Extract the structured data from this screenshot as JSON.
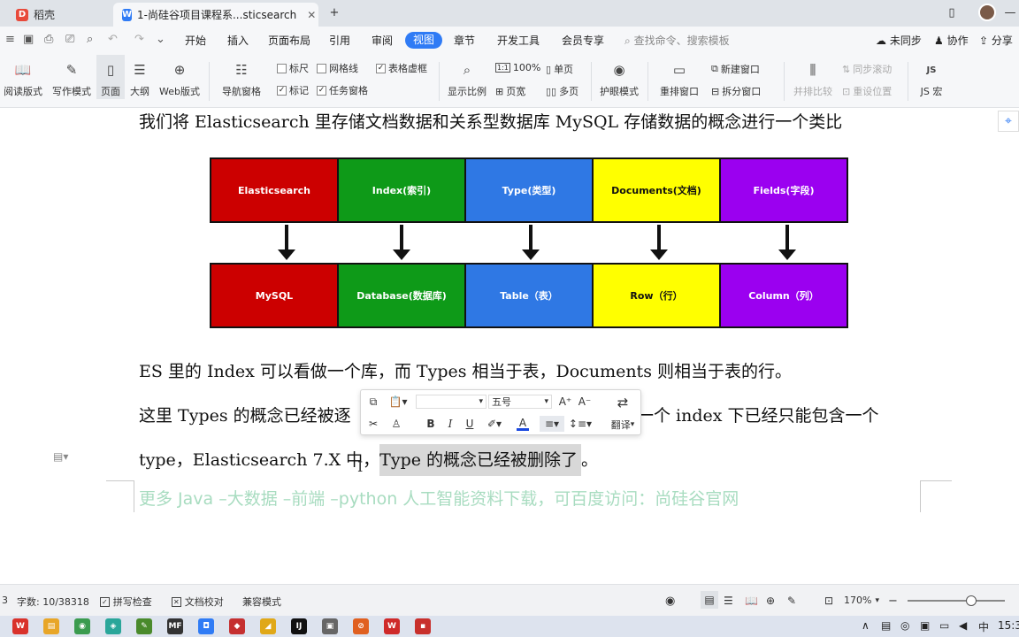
{
  "tabs": [
    {
      "title": "稻壳",
      "logo": "D",
      "color": "#e84a3b"
    },
    {
      "title": "1-尚硅谷项目课程系...sticsearch",
      "logo": "W",
      "color": "#2f7bf5"
    }
  ],
  "window": {
    "new_tab": "+",
    "layout_icon": "window-layout-icon",
    "minimize": "—"
  },
  "menu": {
    "items": [
      "开始",
      "插入",
      "页面布局",
      "引用",
      "审阅",
      "视图",
      "章节",
      "开发工具",
      "会员专享"
    ],
    "active": "视图",
    "search_placeholder": "查找命令、搜索模板",
    "sync": "未同步",
    "collab": "协作",
    "share": "分享"
  },
  "ribbon": {
    "read_mode": "阅读版式",
    "write_mode": "写作模式",
    "page": "页面",
    "outline": "大纲",
    "web": "Web版式",
    "nav_pane": "导航窗格",
    "ruler": "标尺",
    "gridlines": "网格线",
    "table_borders": "表格虚框",
    "marks": "标记",
    "task_pane": "任务窗格",
    "zoom_ratio": "显示比例",
    "hundred": "100%",
    "one_page": "单页",
    "page_width": "页宽",
    "multi_page": "多页",
    "eye_mode": "护眼模式",
    "rearrange": "重排窗口",
    "new_window": "新建窗口",
    "split_window": "拆分窗口",
    "side_by_side": "并排比较",
    "sync_scroll": "同步滚动",
    "reset_pos": "重设位置",
    "js_macro": "JS 宏"
  },
  "document": {
    "line1": "我们将 Elasticsearch 里存储文档数据和关系型数据库 MySQL 存储数据的概念进行一个类比",
    "diagram_top": [
      {
        "label": "Elasticsearch",
        "bg": "#cc0000",
        "fg": "#ffffff"
      },
      {
        "label": "Index(索引)",
        "bg": "#0e9a18",
        "fg": "#ffffff"
      },
      {
        "label": "Type(类型)",
        "bg": "#2f78e4",
        "fg": "#ffffff"
      },
      {
        "label": "Documents(文档)",
        "bg": "#ffff00",
        "fg": "#111111"
      },
      {
        "label": "Fields(字段)",
        "bg": "#9b00f0",
        "fg": "#ffffff"
      }
    ],
    "diagram_bottom": [
      {
        "label": "MySQL",
        "bg": "#cc0000",
        "fg": "#ffffff"
      },
      {
        "label": "Database(数据库)",
        "bg": "#0e9a18",
        "fg": "#ffffff"
      },
      {
        "label": "Table（表）",
        "bg": "#2f78e4",
        "fg": "#ffffff"
      },
      {
        "label": "Row（行）",
        "bg": "#ffff00",
        "fg": "#111111"
      },
      {
        "label": "Column（列）",
        "bg": "#9b00f0",
        "fg": "#ffffff"
      }
    ],
    "line2": "ES 里的 Index 可以看做一个库，而 Types 相当于表，Documents 则相当于表的行。",
    "line3_a": "这里 Types 的概念已经被逐",
    "line3_b": "一个 index 下已经只能包含一个",
    "line4_a": "type，Elasticsearch 7.X 中，",
    "line4_b": "Type 的概念已经被删除了",
    "line4_c": "。",
    "watermark": "更多 Java –大数据 –前端 –python 人工智能资料下载，可百度访问：尚硅谷官网"
  },
  "mini_toolbar": {
    "font_name": "",
    "font_size": "五号",
    "bold": "B",
    "italic": "I",
    "underline": "U",
    "font_color": "A",
    "translate": "翻译"
  },
  "status": {
    "page_no": "3",
    "word_count": "字数: 10/38318",
    "spellcheck": "拼写检查",
    "doc_proof": "文档校对",
    "compat": "兼容模式",
    "zoom": "170%"
  },
  "taskbar": {
    "apps": [
      {
        "name": "wps-app-icon",
        "color": "#d9322b",
        "text": "W"
      },
      {
        "name": "file-explorer-icon",
        "color": "#e8a628",
        "text": "▤"
      },
      {
        "name": "chrome-icon",
        "color": "#3a9b4f",
        "text": "◉"
      },
      {
        "name": "app-icon",
        "color": "#2aa69a",
        "text": "◈"
      },
      {
        "name": "notepad-icon",
        "color": "#4a8a2c",
        "text": "✎"
      },
      {
        "name": "mf-icon",
        "color": "#333333",
        "text": "MF"
      },
      {
        "name": "app-blue-icon",
        "color": "#2f7bf5",
        "text": "◘"
      },
      {
        "name": "app-red-icon",
        "color": "#c53030",
        "text": "◆"
      },
      {
        "name": "jetbrains-icon",
        "color": "#e0a818",
        "text": "◢"
      },
      {
        "name": "idea-icon",
        "color": "#111111",
        "text": "IJ"
      },
      {
        "name": "app-gray-icon",
        "color": "#666666",
        "text": "▣"
      },
      {
        "name": "app-orange-icon",
        "color": "#e06020",
        "text": "⊘"
      },
      {
        "name": "wps-writer-icon",
        "color": "#cf2a2a",
        "text": "W"
      },
      {
        "name": "app-red2-icon",
        "color": "#c8302c",
        "text": "▪"
      }
    ],
    "ime": "中",
    "clock": "15:3"
  }
}
